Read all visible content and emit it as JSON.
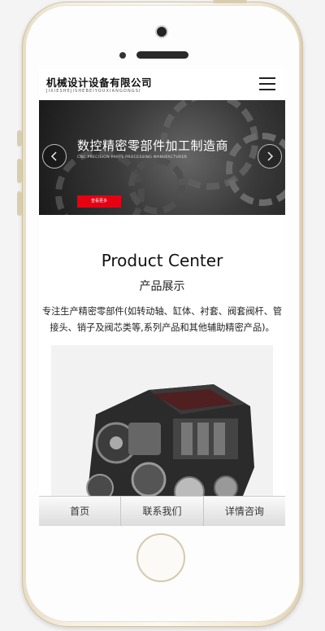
{
  "header": {
    "logo_cn": "机械设计设备有限公司",
    "logo_en": "JIXIESHEJISHEBEIYOUXIANGONGSI"
  },
  "banner": {
    "title": "数控精密零部件加工制造商",
    "subtitle": "CNC PRECISION PARTS PROCESSING MANUFACTURER",
    "button": "查看更多",
    "accent": "#e50012"
  },
  "section": {
    "title": "Product Center",
    "subtitle": "产品展示",
    "description": "专注生产精密零部件(如转动轴、缸体、衬套、阀套阀杆、管接头、销子及阀芯类等,系列产品和其他辅助精密产品)。"
  },
  "footer": {
    "items": [
      "首页",
      "联系我们",
      "详情咨询"
    ]
  },
  "icons": {
    "menu": "menu-icon",
    "prev": "chevron-left-icon",
    "next": "chevron-right-icon"
  }
}
